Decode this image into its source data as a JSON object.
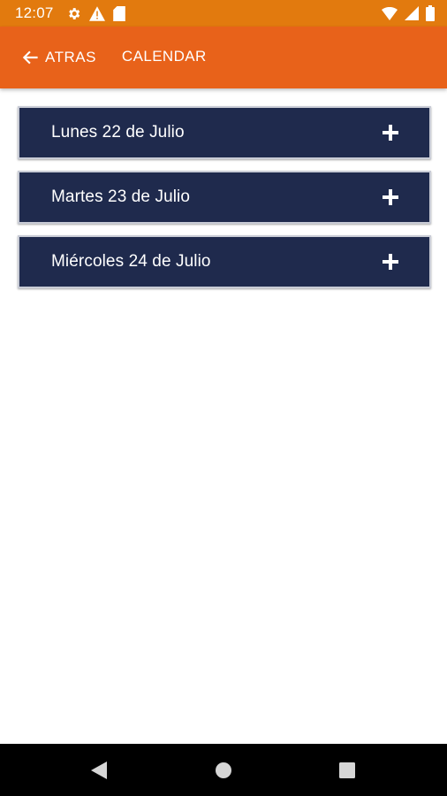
{
  "status_bar": {
    "time": "12:07",
    "icons_left": [
      "gear-icon",
      "warning-icon",
      "sd-card-icon"
    ],
    "icons_right": [
      "wifi-icon",
      "cell-signal-icon",
      "battery-icon"
    ]
  },
  "app_bar": {
    "back_label": "ATRAS",
    "title": "CALENDAR"
  },
  "days": [
    {
      "label": "Lunes 22 de Julio",
      "icon": "plus-icon"
    },
    {
      "label": "Martes 23 de Julio",
      "icon": "plus-icon"
    },
    {
      "label": "Miércoles 24 de Julio",
      "icon": "plus-icon"
    }
  ],
  "nav_bar": {
    "buttons": [
      "back-triangle-icon",
      "home-circle-icon",
      "recents-square-icon"
    ]
  },
  "colors": {
    "status_bar": "#e27a0e",
    "app_bar": "#e8621a",
    "day_item_bg": "#1f2a4d",
    "nav_bar": "#000000"
  }
}
